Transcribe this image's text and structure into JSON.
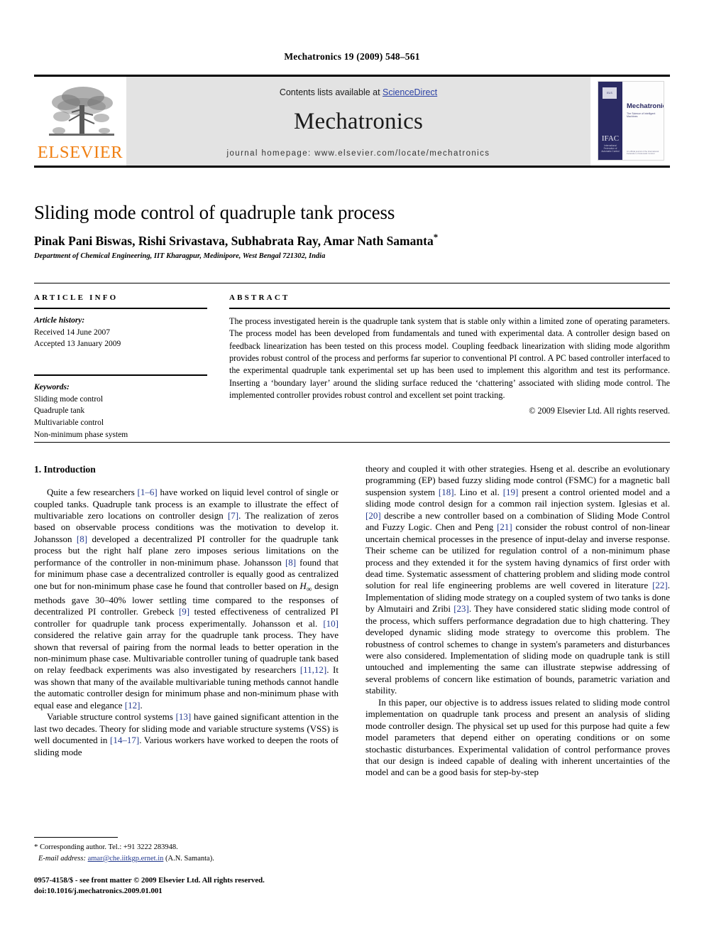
{
  "running_head": "Mechatronics 19 (2009) 548–561",
  "masthead": {
    "publisher_logo_text": "ELSEVIER",
    "publisher_logo_icon": "elsevier-tree-logo",
    "contents_prefix": "Contents lists available at ",
    "contents_link": "ScienceDirect",
    "journal_name": "Mechatronics",
    "homepage_line": "journal homepage: www.elsevier.com/locate/mechatronics",
    "accent_orange": "#f07f12",
    "link_blue": "#2b41a5",
    "banner_bg": "#e3e3e3",
    "cover": {
      "journal_title": "Mechatronics",
      "tagline": "The Science of Intelligent Machines",
      "badge_text": "ELS",
      "society_glyph": "IFAC",
      "society_sub": "International Federation of Automatic Control",
      "footer_text": "An official journal of the International Federation of Automatic Control",
      "strip_color": "#2b2b63"
    }
  },
  "article": {
    "title": "Sliding mode control of quadruple tank process",
    "authors": "Pinak Pani Biswas, Rishi Srivastava, Subhabrata Ray, Amar Nath Samanta",
    "corresponding_marker": "*",
    "affiliation": "Department of Chemical Engineering, IIT Kharagpur, Medinipore, West Bengal 721302, India"
  },
  "article_info": {
    "heading": "ARTICLE INFO",
    "history_label": "Article history:",
    "received": "Received 14 June 2007",
    "accepted": "Accepted 13 January 2009",
    "keywords_label": "Keywords:",
    "keywords": [
      "Sliding mode control",
      "Quadruple tank",
      "Multivariable control",
      "Non-minimum phase system"
    ]
  },
  "abstract": {
    "heading": "ABSTRACT",
    "text": "The process investigated herein is the quadruple tank system that is stable only within a limited zone of operating parameters. The process model has been developed from fundamentals and tuned with experimental data. A controller design based on feedback linearization has been tested on this process model. Coupling feedback linearization with sliding mode algorithm provides robust control of the process and performs far superior to conventional PI control. A PC based controller interfaced to the experimental quadruple tank experimental set up has been used to implement this algorithm and test its performance. Inserting a ‘boundary layer’ around the sliding surface reduced the ‘chattering’ associated with sliding mode control. The implemented controller provides robust control and excellent set point tracking.",
    "copyright": "© 2009 Elsevier Ltd. All rights reserved."
  },
  "body": {
    "section_heading": "1. Introduction",
    "left_paragraphs": [
      "Quite a few researchers [1–6] have worked on liquid level control of single or coupled tanks. Quadruple tank process is an example to illustrate the effect of multivariable zero locations on controller design [7]. The realization of zeros based on observable process conditions was the motivation to develop it. Johansson [8] developed a decentralized PI controller for the quadruple tank process but the right half plane zero imposes serious limitations on the performance of the controller in non-minimum phase. Johansson [8] found that for minimum phase case a decentralized controller is equally good as centralized one but for non-minimum phase case he found that controller based on H∞ design methods gave 30–40% lower settling time compared to the responses of decentralized PI controller. Grebeck [9] tested effectiveness of centralized PI controller for quadruple tank process experimentally. Johansson et al. [10] considered the relative gain array for the quadruple tank process. They have shown that reversal of pairing from the normal leads to better operation in the non-minimum phase case. Multivariable controller tuning of quadruple tank based on relay feedback experiments was also investigated by researchers [11,12]. It was shown that many of the available multivariable tuning methods cannot handle the automatic controller design for minimum phase and non-minimum phase with equal ease and elegance [12].",
      "Variable structure control systems [13] have gained significant attention in the last two decades. Theory for sliding mode and variable structure systems (VSS) is well documented in [14–17]. Various workers have worked to deepen the roots of sliding mode"
    ],
    "right_paragraphs": [
      "theory and coupled it with other strategies. Hseng et al. describe an evolutionary programming (EP) based fuzzy sliding mode control (FSMC) for a magnetic ball suspension system [18]. Lino et al. [19] present a control oriented model and a sliding mode control design for a common rail injection system. Iglesias et al. [20] describe a new controller based on a combination of Sliding Mode Control and Fuzzy Logic. Chen and Peng [21] consider the robust control of non-linear uncertain chemical processes in the presence of input-delay and inverse response. Their scheme can be utilized for regulation control of a non-minimum phase process and they extended it for the system having dynamics of first order with dead time. Systematic assessment of chattering problem and sliding mode control solution for real life engineering problems are well covered in literature [22]. Implementation of sliding mode strategy on a coupled system of two tanks is done by Almutairi and Zribi [23]. They have considered static sliding mode control of the process, which suffers performance degradation due to high chattering. They developed dynamic sliding mode strategy to overcome this problem. The robustness of control schemes to change in system's parameters and disturbances were also considered. Implementation of sliding mode on quadruple tank is still untouched and implementing the same can illustrate stepwise addressing of several problems of concern like estimation of bounds, parametric variation and stability.",
      "In this paper, our objective is to address issues related to sliding mode control implementation on quadruple tank process and present an analysis of sliding mode controller design. The physical set up used for this purpose had quite a few model parameters that depend either on operating conditions or on some stochastic disturbances. Experimental validation of control performance proves that our design is indeed capable of dealing with inherent uncertainties of the model and can be a good basis for step-by-step"
    ]
  },
  "footnote": {
    "marker": "*",
    "corresponding": "Corresponding author. Tel.: +91 3222 283948.",
    "email_label": "E-mail address:",
    "email": "amar@che.iitkgp.ernet.in",
    "email_owner": "(A.N. Samanta)."
  },
  "footer": {
    "issn_line": "0957-4158/$ - see front matter © 2009 Elsevier Ltd. All rights reserved.",
    "doi_line": "doi:10.1016/j.mechatronics.2009.01.001"
  }
}
